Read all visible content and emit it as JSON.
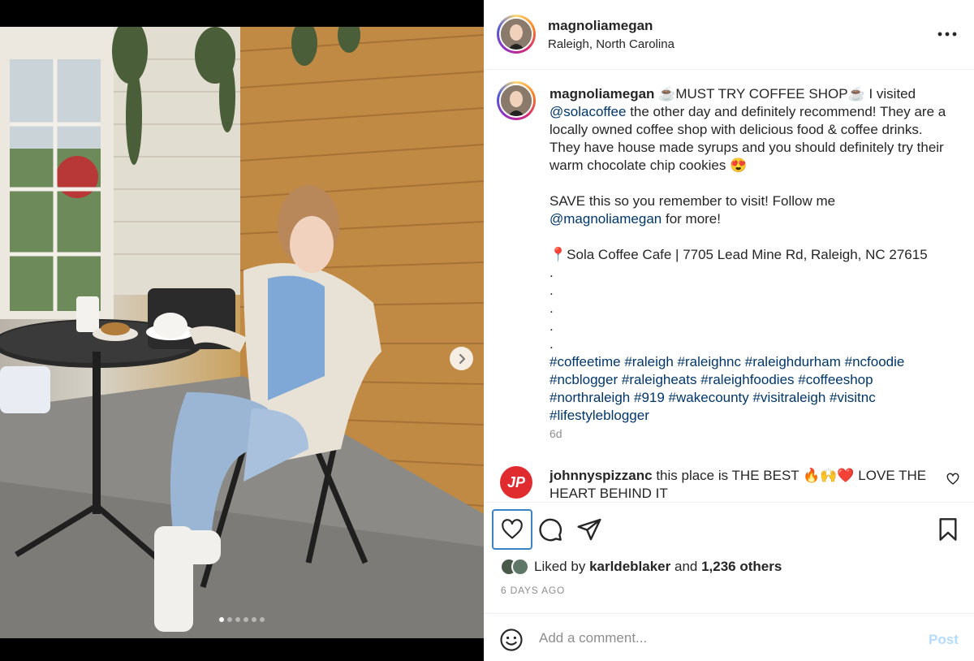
{
  "post": {
    "username": "magnoliamegan",
    "location": "Raleigh, North Carolina"
  },
  "photo": {
    "total_slides": 6,
    "active_slide": 1
  },
  "caption": {
    "username": "magnoliamegan",
    "line1_a": "☕MUST TRY COFFEE SHOP☕ I visited",
    "mention_1": "@solacoffee",
    "line1_b": "the other day and definitely recommend! They are a locally owned coffee shop with delicious food & coffee drinks. They have house made syrups and you should definitely try their warm chocolate chip cookies 😍",
    "line2_a": "SAVE this so you remember to visit! Follow me",
    "mention_2": "@magnoliamegan",
    "line2_b": "for more!",
    "address": "📍Sola Coffee Cafe | 7705 Lead Mine Rd, Raleigh, NC 27615",
    "dots": [
      ".",
      ".",
      ".",
      ".",
      "."
    ],
    "hashtags": [
      "#coffeetime",
      "#raleigh",
      "#raleighnc",
      "#raleighdurham",
      "#ncfoodie",
      "#ncblogger",
      "#raleigheats",
      "#raleighfoodies",
      "#coffeeshop",
      "#northraleigh",
      "#919",
      "#wakecounty",
      "#visitraleigh",
      "#visitnc",
      "#lifestyleblogger"
    ],
    "time": "6d"
  },
  "comment": {
    "avatar_text": "JP",
    "username": "johnnyspizzanc",
    "text": "this place is THE BEST 🔥🙌❤️ LOVE THE HEART BEHIND IT"
  },
  "likes": {
    "prefix": "Liked by",
    "user": "karldeblaker",
    "and": "and",
    "others": "1,236 others"
  },
  "date": "6 DAYS AGO",
  "add_comment": {
    "placeholder": "Add a comment...",
    "post_label": "Post"
  },
  "icons": {
    "more": "more-options-icon",
    "next": "chevron-right-icon",
    "like": "heart-outline-icon",
    "comment": "speech-bubble-icon",
    "share": "paper-plane-icon",
    "save": "bookmark-icon",
    "emoji": "smiley-icon"
  },
  "colors": {
    "link": "#00376b",
    "secondary_text": "#8e8e8e",
    "post_button_disabled": "#b3dbff",
    "comment_avatar": "#e02b2f",
    "like_focus_border": "#3b82c4"
  }
}
